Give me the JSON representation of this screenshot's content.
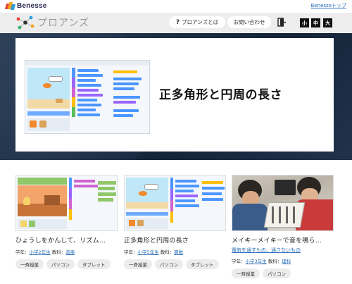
{
  "top_bar": {
    "brand": "Benesse",
    "top_link": "Benesseトップ"
  },
  "header": {
    "logo_text": "プロアンズ",
    "nav": {
      "about_icon": "?",
      "about_label": "プロアンズとは",
      "contact_label": "お問い合わせ"
    },
    "exit_icon": "exit-door-icon",
    "text_size": {
      "small": "小",
      "medium": "中",
      "large": "大"
    }
  },
  "hero": {
    "title": "正多角形と円周の長さ"
  },
  "cards": [
    {
      "title": "ひょうしをかんして、リズム…",
      "subtitle": "",
      "grade_label": "学年：",
      "grade": "小学2年生",
      "subject_label": "教科：",
      "subject": "音楽",
      "tags": [
        "一斉授業",
        "パソコン",
        "タブレット"
      ]
    },
    {
      "title": "正多角形と円周の長さ",
      "subtitle": "",
      "grade_label": "学年：",
      "grade": "小学5年生",
      "subject_label": "教科：",
      "subject": "算数",
      "tags": [
        "一斉授業",
        "パソコン",
        "タブレット"
      ]
    },
    {
      "title": "メイキーメイキーで音を鳴ら…",
      "subtitle": "電気を通すもの、通さないもの",
      "grade_label": "学年：",
      "grade": "小学3年生",
      "subject_label": "教科：",
      "subject": "理科",
      "tags": [
        "一斉授業",
        "パソコン"
      ]
    }
  ],
  "colors": {
    "header_bg": "#ededed",
    "hero_bg": "#1b2a40",
    "link": "#2a6fb8",
    "tag_bg": "#ececec"
  }
}
